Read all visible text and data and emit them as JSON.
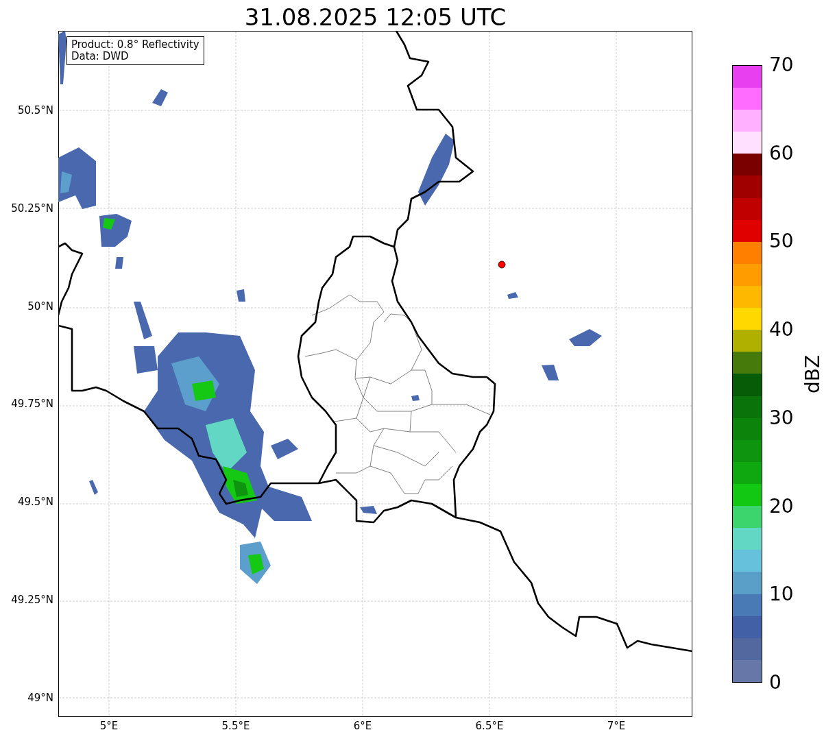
{
  "title": "31.08.2025 12:05 UTC",
  "map": {
    "info_box": [
      "Product: 0.8° Reflectivity",
      "Data: DWD"
    ],
    "lat_labels": [
      "50.5°N",
      "50.25°N",
      "50°N",
      "49.75°N",
      "49.5°N",
      "49.25°N",
      "49°N"
    ],
    "lon_labels": [
      "5°E",
      "5.5°E",
      "6°E",
      "6.5°E",
      "7°E"
    ]
  },
  "colorbar": {
    "label": "dBZ",
    "ticks": [
      "70",
      "60",
      "50",
      "40",
      "30",
      "20",
      "10",
      "0"
    ],
    "segments": [
      {
        "color": "#6677a8"
      },
      {
        "color": "#5468a0"
      },
      {
        "color": "#4260a5"
      },
      {
        "color": "#4a7ab5"
      },
      {
        "color": "#5a9fc8"
      },
      {
        "color": "#66c2dc"
      },
      {
        "color": "#62d8c4"
      },
      {
        "color": "#3cd46c"
      },
      {
        "color": "#12c812"
      },
      {
        "color": "#10a810"
      },
      {
        "color": "#0e940e"
      },
      {
        "color": "#0c840c"
      },
      {
        "color": "#0a740a"
      },
      {
        "color": "#075d07"
      },
      {
        "color": "#467a0a"
      },
      {
        "color": "#b0b000"
      },
      {
        "color": "#ffd800"
      },
      {
        "color": "#ffb800"
      },
      {
        "color": "#ff9c00"
      },
      {
        "color": "#ff7f00"
      },
      {
        "color": "#e00000"
      },
      {
        "color": "#c00000"
      },
      {
        "color": "#a00000"
      },
      {
        "color": "#7a0000"
      },
      {
        "color": "#ffe0ff"
      },
      {
        "color": "#ffb0ff"
      },
      {
        "color": "#ff6cff"
      },
      {
        "color": "#e840f0"
      }
    ]
  }
}
